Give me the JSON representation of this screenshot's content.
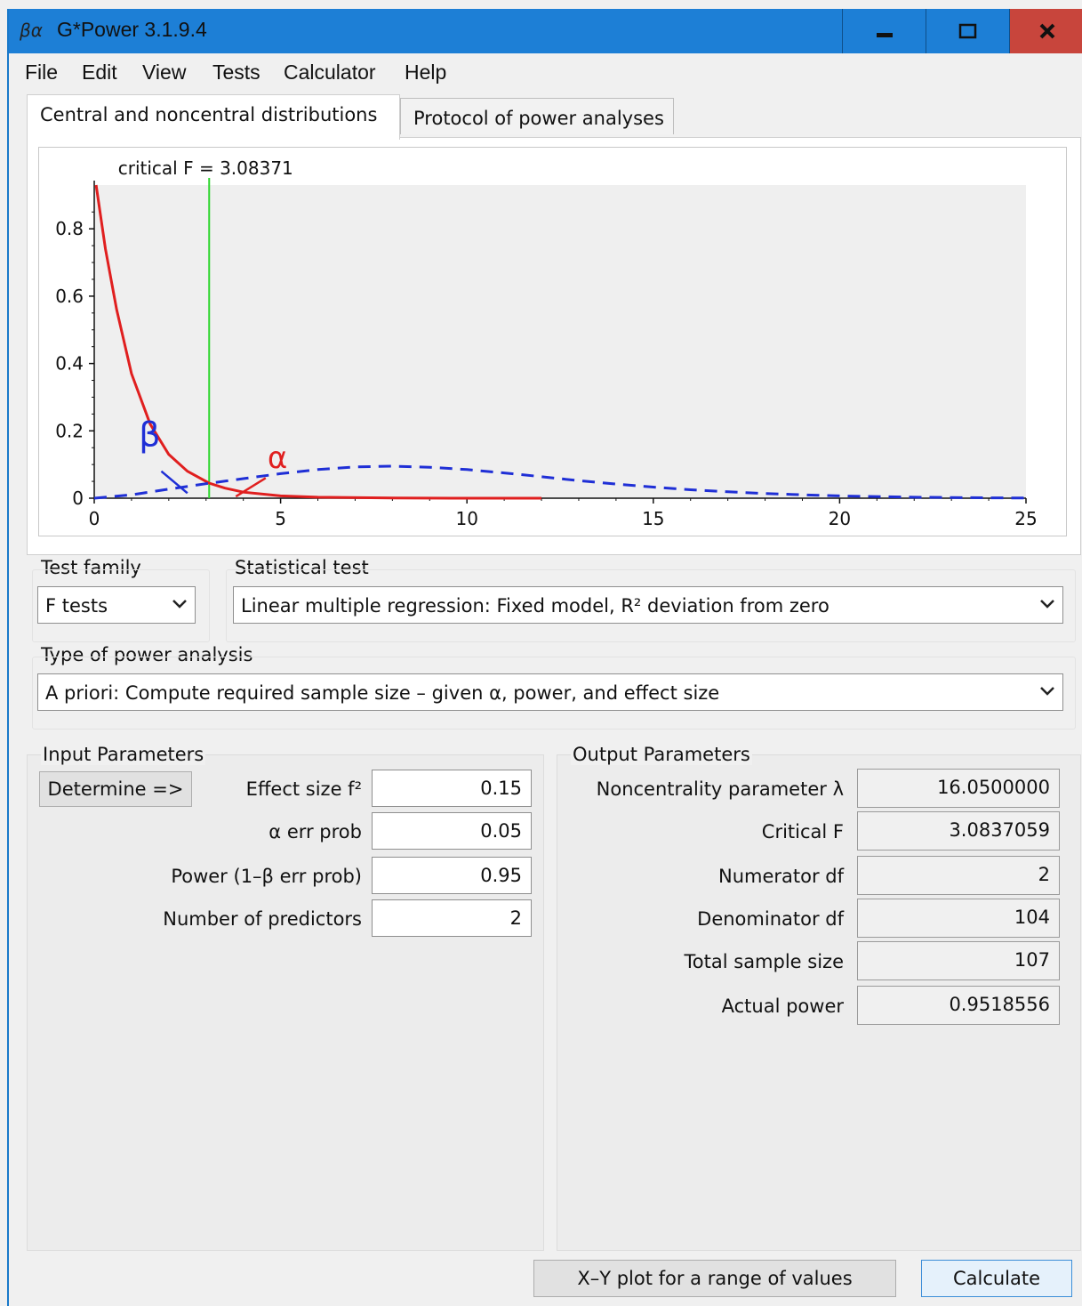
{
  "window": {
    "title": "G*Power 3.1.9.4",
    "app_icon_text": "βα"
  },
  "menu": [
    "File",
    "Edit",
    "View",
    "Tests",
    "Calculator",
    "Help"
  ],
  "tabs": {
    "active": "Central and noncentral distributions",
    "inactive": "Protocol of power analyses"
  },
  "chart_data": {
    "type": "line",
    "annotation": "critical F = 3.08371",
    "critical_f": 3.08371,
    "xlim": [
      0,
      25
    ],
    "ylim": [
      0,
      0.93
    ],
    "x_ticks": [
      "0",
      "5",
      "10",
      "15",
      "20",
      "25"
    ],
    "y_ticks": [
      "0",
      "0.2",
      "0.4",
      "0.6",
      "0.8"
    ],
    "series": [
      {
        "style": "solid",
        "color": "#e01f1f",
        "points": [
          [
            0.05,
            0.93
          ],
          [
            0.3,
            0.74
          ],
          [
            0.6,
            0.56
          ],
          [
            1.0,
            0.37
          ],
          [
            1.5,
            0.22
          ],
          [
            2.0,
            0.13
          ],
          [
            2.5,
            0.08
          ],
          [
            3.08,
            0.045
          ],
          [
            3.5,
            0.03
          ],
          [
            4.0,
            0.018
          ],
          [
            5.0,
            0.007
          ],
          [
            6.0,
            0.003
          ],
          [
            8.0,
            0.0005
          ],
          [
            10.0,
            0.0001
          ],
          [
            12.0,
            0.0
          ]
        ]
      },
      {
        "style": "dashed",
        "color": "#1f2fd6",
        "points": [
          [
            0,
            0.0
          ],
          [
            1,
            0.01
          ],
          [
            2,
            0.027
          ],
          [
            3,
            0.043
          ],
          [
            4,
            0.058
          ],
          [
            5,
            0.073
          ],
          [
            6,
            0.085
          ],
          [
            7,
            0.093
          ],
          [
            8,
            0.095
          ],
          [
            9,
            0.092
          ],
          [
            10,
            0.085
          ],
          [
            11,
            0.075
          ],
          [
            12,
            0.064
          ],
          [
            13,
            0.052
          ],
          [
            14,
            0.042
          ],
          [
            15,
            0.033
          ],
          [
            16,
            0.025
          ],
          [
            17,
            0.019
          ],
          [
            18,
            0.014
          ],
          [
            19,
            0.01
          ],
          [
            20,
            0.007
          ],
          [
            22,
            0.003
          ],
          [
            24,
            0.001
          ],
          [
            25,
            0.0005
          ]
        ]
      }
    ],
    "beta_label": "β",
    "alpha_label": "α"
  },
  "test_family": {
    "label": "Test family",
    "value": "F tests"
  },
  "statistical_test": {
    "label": "Statistical test",
    "value": "Linear multiple regression: Fixed model, R² deviation from zero"
  },
  "power_analysis": {
    "label": "Type of power analysis",
    "value": "A priori: Compute required sample size – given α, power, and effect size"
  },
  "input": {
    "title": "Input Parameters",
    "determine_label": "Determine =>",
    "params": [
      {
        "label": "Effect size f²",
        "value": "0.15"
      },
      {
        "label": "α err prob",
        "value": "0.05"
      },
      {
        "label": "Power (1–β err prob)",
        "value": "0.95"
      },
      {
        "label": "Number of predictors",
        "value": "2"
      }
    ]
  },
  "output": {
    "title": "Output Parameters",
    "params": [
      {
        "label": "Noncentrality parameter λ",
        "value": "16.0500000"
      },
      {
        "label": "Critical F",
        "value": "3.0837059"
      },
      {
        "label": "Numerator df",
        "value": "2"
      },
      {
        "label": "Denominator df",
        "value": "104"
      },
      {
        "label": "Total sample size",
        "value": "107"
      },
      {
        "label": "Actual power",
        "value": "0.9518556"
      }
    ]
  },
  "buttons": {
    "xy_plot": "X–Y plot for a range of values",
    "calculate": "Calculate"
  }
}
